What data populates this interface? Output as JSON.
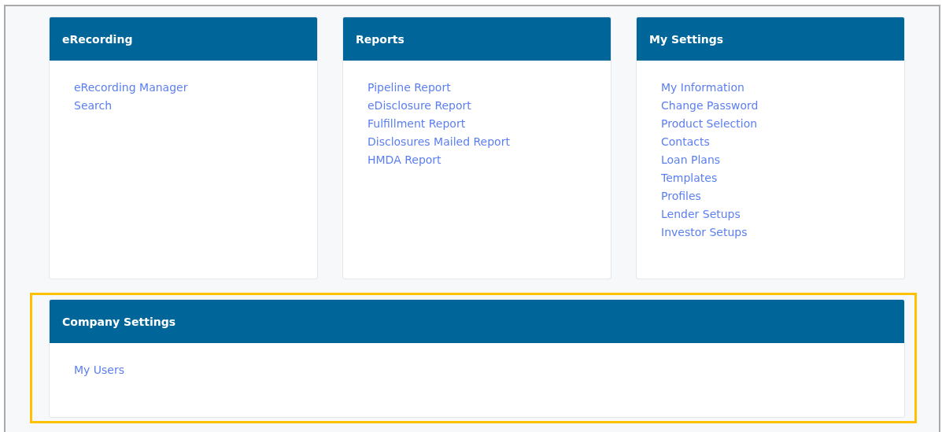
{
  "panels": [
    {
      "title": "eRecording",
      "links": [
        "eRecording Manager",
        "Search"
      ]
    },
    {
      "title": "Reports",
      "links": [
        "Pipeline Report",
        "eDisclosure Report",
        "Fulfillment Report",
        "Disclosures Mailed Report",
        "HMDA Report"
      ]
    },
    {
      "title": "My Settings",
      "links": [
        "My Information",
        "Change Password",
        "Product Selection",
        "Contacts",
        "Loan Plans",
        "Templates",
        "Profiles",
        "Lender Setups",
        "Investor Setups"
      ]
    }
  ],
  "company_settings": {
    "title": "Company Settings",
    "highlighted": true,
    "links": [
      "My Users"
    ]
  }
}
